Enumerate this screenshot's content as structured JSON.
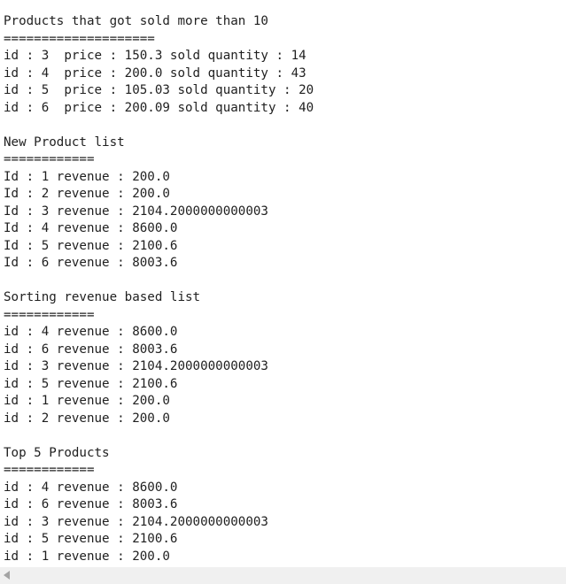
{
  "console": {
    "lines": [
      "Products that got sold more than 10",
      "====================",
      "id : 3  price : 150.3 sold quantity : 14",
      "id : 4  price : 200.0 sold quantity : 43",
      "id : 5  price : 105.03 sold quantity : 20",
      "id : 6  price : 200.09 sold quantity : 40",
      "",
      "New Product list",
      "============",
      "Id : 1 revenue : 200.0",
      "Id : 2 revenue : 200.0",
      "Id : 3 revenue : 2104.2000000000003",
      "Id : 4 revenue : 8600.0",
      "Id : 5 revenue : 2100.6",
      "Id : 6 revenue : 8003.6",
      "",
      "Sorting revenue based list",
      "============",
      "id : 4 revenue : 8600.0",
      "id : 6 revenue : 8003.6",
      "id : 3 revenue : 2104.2000000000003",
      "id : 5 revenue : 2100.6",
      "id : 1 revenue : 200.0",
      "id : 2 revenue : 200.0",
      "",
      "Top 5 Products",
      "============",
      "id : 4 revenue : 8600.0",
      "id : 6 revenue : 8003.6",
      "id : 3 revenue : 2104.2000000000003",
      "id : 5 revenue : 2100.6",
      "id : 1 revenue : 200.0"
    ]
  },
  "scrollbar": {
    "left_arrow_icon": "triangle-left-icon"
  }
}
